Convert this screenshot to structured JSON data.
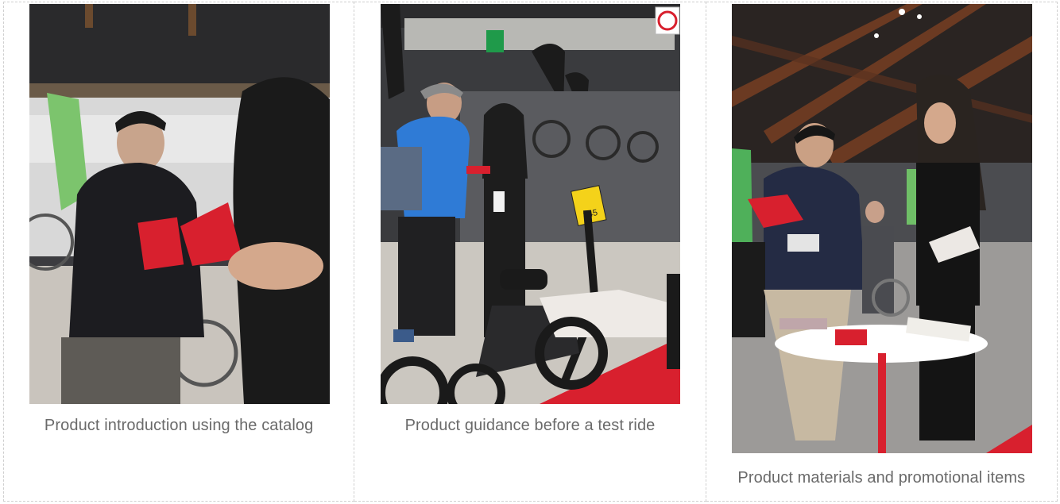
{
  "panels": [
    {
      "caption": "Product introduction using the catalog",
      "photo": "photo-catalog-introduction"
    },
    {
      "caption": "Product guidance before a test ride",
      "photo": "photo-test-ride-guidance"
    },
    {
      "caption": "Product materials and promotional items",
      "photo": "photo-promotional-items"
    }
  ],
  "signage": {
    "booth_tag": "845"
  },
  "colors": {
    "caption_text": "#6a6a6a",
    "border": "#cfcfcf",
    "accent_red": "#d8202e",
    "brand_green": "#5fbf5a"
  }
}
